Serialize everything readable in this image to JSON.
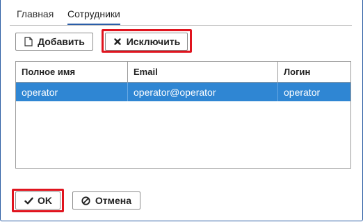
{
  "tabs": [
    {
      "label": "Главная"
    },
    {
      "label": "Сотрудники"
    }
  ],
  "toolbar": {
    "add_label": "Добавить",
    "exclude_label": "Исключить"
  },
  "table": {
    "columns": [
      "Полное имя",
      "Email",
      "Логин"
    ],
    "rows": [
      {
        "full_name": "operator",
        "email": "operator@operator",
        "login": "operator",
        "selected": true
      }
    ]
  },
  "footer": {
    "ok_label": "OK",
    "cancel_label": "Отмена"
  },
  "colors": {
    "accent": "#2f86d3",
    "highlight": "#e0141e",
    "frame": "#2b5da3"
  }
}
